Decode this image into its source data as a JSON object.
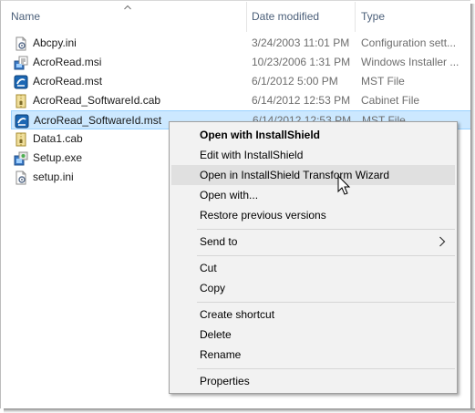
{
  "columns": {
    "name": "Name",
    "date_modified": "Date modified",
    "type": "Type"
  },
  "files": [
    {
      "name": "Abcpy.ini",
      "date": "3/24/2003 11:01 PM",
      "type": "Configuration sett...",
      "icon": "ini-file-icon"
    },
    {
      "name": "AcroRead.msi",
      "date": "10/23/2006 1:31 PM",
      "type": "Windows Installer ...",
      "icon": "msi-file-icon"
    },
    {
      "name": "AcroRead.mst",
      "date": "6/1/2012 5:00 PM",
      "type": "MST File",
      "icon": "mst-file-icon"
    },
    {
      "name": "AcroRead_SoftwareId.cab",
      "date": "6/14/2012 12:53 PM",
      "type": "Cabinet File",
      "icon": "cab-file-icon"
    },
    {
      "name": "AcroRead_SoftwareId.mst",
      "date": "6/14/2012 12:53 PM",
      "type": "MST File",
      "icon": "mst-file-icon"
    },
    {
      "name": "Data1.cab",
      "date": "",
      "type": "",
      "icon": "cab-file-icon"
    },
    {
      "name": "Setup.exe",
      "date": "",
      "type": "",
      "icon": "setup-exe-icon"
    },
    {
      "name": "setup.ini",
      "date": "",
      "type": "",
      "icon": "ini-file-icon"
    }
  ],
  "context_menu": {
    "open_with_installshield": "Open with InstallShield",
    "edit_with_installshield": "Edit with InstallShield",
    "open_transform_wizard": "Open in InstallShield Transform Wizard",
    "open_with": "Open with...",
    "restore_previous": "Restore previous versions",
    "send_to": "Send to",
    "cut": "Cut",
    "copy": "Copy",
    "create_shortcut": "Create shortcut",
    "delete": "Delete",
    "rename": "Rename",
    "properties": "Properties"
  },
  "colors": {
    "selection_bg": "#cce8ff",
    "selection_border": "#99d1ff",
    "menu_bg": "#f2f2f2",
    "menu_highlight": "#e0e0e0",
    "header_text": "#4c607a"
  }
}
